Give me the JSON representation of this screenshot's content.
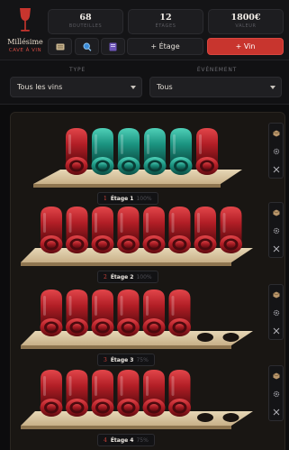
{
  "brand": {
    "title": "Millésime",
    "subtitle": "CAVE À VIN",
    "accent": "#c8352e",
    "icon": "wine-glass-icon"
  },
  "stats": [
    {
      "value": "68",
      "label": "BOUTEILLES"
    },
    {
      "value": "12",
      "label": "ÉTAGES"
    },
    {
      "value": "1800€",
      "label": "VALEUR"
    }
  ],
  "toolbar": {
    "icons": [
      "wine-list-icon",
      "search-icon",
      "book-icon"
    ],
    "add_shelf_label": "+ Étage",
    "add_wine_label": "+ Vin"
  },
  "filters": {
    "type_label": "TYPE",
    "type_value": "Tous les vins",
    "event_label": "ÉVÉNEMENT",
    "event_value": "Tous"
  },
  "colors": {
    "red_wine": "#b8262a",
    "white_wine": "#1f9a8a",
    "shelf_wood": "#d9c59f"
  },
  "shelves": [
    {
      "number": "1",
      "name": "Étage 1",
      "percent": "100%",
      "bottles": [
        "red",
        "teal",
        "teal",
        "teal",
        "teal",
        "red"
      ]
    },
    {
      "number": "2",
      "name": "Étage 2",
      "percent": "100%",
      "bottles": [
        "red",
        "red",
        "red",
        "red",
        "red",
        "red",
        "red",
        "red"
      ]
    },
    {
      "number": "3",
      "name": "Étage 3",
      "percent": "75%",
      "bottles": [
        "red",
        "red",
        "red",
        "red",
        "red",
        "red",
        "empty",
        "empty"
      ]
    },
    {
      "number": "4",
      "name": "Étage 4",
      "percent": "75%",
      "bottles": [
        "red",
        "red",
        "red",
        "red",
        "red",
        "red",
        "empty",
        "empty"
      ]
    }
  ]
}
